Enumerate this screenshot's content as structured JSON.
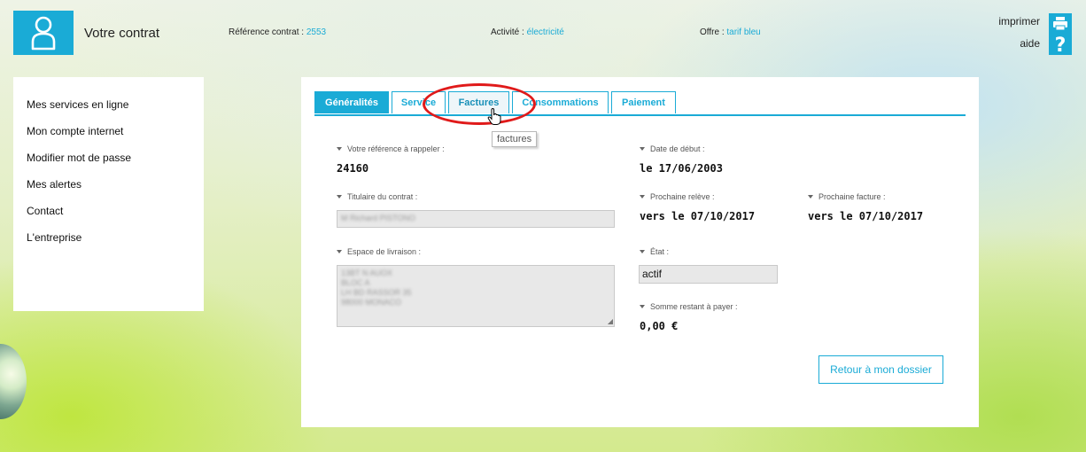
{
  "header": {
    "title": "Votre contrat",
    "contract_ref": {
      "label": "Référence contrat : ",
      "value": "2553"
    },
    "activity": {
      "label": "Activité : ",
      "value": "électricité"
    },
    "offer": {
      "label": "Offre : ",
      "value": "tarif bleu"
    },
    "print_label": "imprimer",
    "help_label": "aide"
  },
  "sidebar": {
    "items": [
      {
        "label": "Mes services en ligne"
      },
      {
        "label": "Mon compte internet"
      },
      {
        "label": "Modifier mot de passe"
      },
      {
        "label": "Mes alertes"
      },
      {
        "label": "Contact"
      },
      {
        "label": "L'entreprise"
      }
    ]
  },
  "tabs": [
    {
      "label": "Généralités",
      "active": true
    },
    {
      "label": "Service"
    },
    {
      "label": "Factures",
      "hover": true
    },
    {
      "label": "Consommations"
    },
    {
      "label": "Paiement"
    }
  ],
  "tooltip": "factures",
  "fields": {
    "ref_label": "Votre référence à rappeler :",
    "ref_value": "24160",
    "start_label": "Date de début :",
    "start_value": "le 17/06/2003",
    "holder_label": "Titulaire du contrat :",
    "holder_value": "M Richard PISTONO",
    "next_reading_label": "Prochaine relève :",
    "next_reading_value": "vers le 07/10/2017",
    "next_invoice_label": "Prochaine facture :",
    "next_invoice_value": "vers le 07/10/2017",
    "delivery_label": "Espace de livraison :",
    "delivery_value": "13BT N AUOX\nBLOC A\nLH BD RASSOR 35\n98000 MONACO",
    "status_label": "État :",
    "status_value": "actif",
    "balance_label": "Somme restant à payer :",
    "balance_value": "0,00 €"
  },
  "back_button": "Retour à mon dossier",
  "colors": {
    "accent": "#1aabd6",
    "highlight": "#e01a1a"
  }
}
